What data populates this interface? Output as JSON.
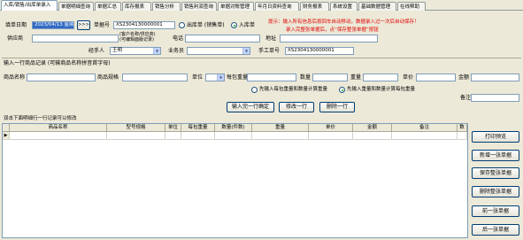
{
  "tabs": [
    "入库/销售/出库单录入",
    "单据明细查询",
    "单据汇总",
    "库存报表",
    "销售分析",
    "销售利润查询",
    "单据对账管理",
    "年月日资料查询",
    "财务报表",
    "系统设置",
    "基础数据管理",
    "在线帮助"
  ],
  "form": {
    "date_label": "填单日期",
    "date_value": "2023/04/13 星期四",
    "date_btn": ">>>",
    "docno_label": "单据号",
    "docno_value": "XS2304130000001",
    "radio_out": "出库单 (销售单)",
    "radio_in": "入库单",
    "tip_line1": "提示：输入所有信息后按回车自动移动，数据录入过一次后自动保存！",
    "tip_line2": "录入完整张单据后，点“保存整张单据”按钮",
    "supplier_label": "供应商",
    "customer_label": "(客户名称/供应商)",
    "customer_label2": "(可编辑面版记录)",
    "phone_label": "电话",
    "address_label": "地址",
    "handler_label": "经手人",
    "handler_value": "王明",
    "salesman_label": "业务员",
    "manual_label": "手工单号",
    "manual_value": "XS2304130000001"
  },
  "entry": {
    "section_title": "输入一行商品记录 (可输商品名称拼音首字母)",
    "name_label": "商品名称",
    "spec_label": "商品规格",
    "unit_label": "单位",
    "weight_label": "每包重量",
    "qty_label": "数量",
    "totalw_label": "重量",
    "price_label": "单价",
    "amount_label": "金额",
    "opt1": "先输入每包重量和数量计算重量",
    "opt2": "先输入重量和数量计算每包重量",
    "note_label": "备注",
    "btn_confirm": "输入完一行确定",
    "btn_edit": "修改一行",
    "btn_delete": "删除一行"
  },
  "grid": {
    "caption": "双击下面明细行一行记录可以修改",
    "columns": [
      "商品名称",
      "型号规格",
      "单位",
      "每包重量",
      "数量(件数)",
      "重量",
      "单价",
      "金额",
      "备注",
      "数"
    ]
  },
  "side_buttons": [
    "打印预览",
    "新增一张单据",
    "保存整张单据",
    "删除整张单据",
    "前一张单据",
    "后一张单据"
  ]
}
